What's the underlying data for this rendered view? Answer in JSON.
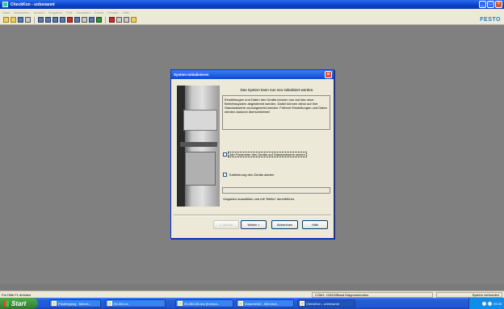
{
  "window": {
    "title": "CheckKon - unbenannt",
    "menu": [
      "Datei",
      "Bearbeiten",
      "Ansicht",
      "Vorgaben",
      "Prüf",
      "Verwalten",
      "Extras",
      "Fenster",
      "Hilfe"
    ],
    "brand": "FESTO",
    "controls": {
      "minimize": "_",
      "maximize": "□",
      "close": "×"
    }
  },
  "toolbar": {
    "icons": [
      "new-icon",
      "open-icon",
      "save-icon",
      "print-icon",
      "grid-icon",
      "grid-icon",
      "grid-icon",
      "grid-icon",
      "grid-icon",
      "grid-icon",
      "grid-icon",
      "grid-icon",
      "grid-icon",
      "cut-icon",
      "delete-icon",
      "zoom-icon",
      "help-icon"
    ]
  },
  "dialog": {
    "title": "System Initialisieren",
    "close_glyph": "×",
    "heading": "Das System kann nun neu initialisiert werden.",
    "info": "Einstellungen und Daten des Geräts können nun auf das neue Betriebssystem abgestimmt werden. Dabei können diese auf ihre Standardwerte zurückgesetzt werden. Frühere Einstellungen und Daten werden dadurch überschrieben!",
    "checkbox1": {
      "label": "Alle Parameter des Geräts auf Standardwerte setzen",
      "checked": false
    },
    "checkbox2": {
      "label": "Kalibrierung des Geräts starten",
      "checked": false
    },
    "progress": 0,
    "hint": "Vorgaben auswählen und mit 'Weiter' durchführen.",
    "buttons": {
      "back": "< Zurück",
      "next": "Weiter >",
      "cancel": "Abbrechen",
      "help": "Hilfe"
    }
  },
  "statusbar": {
    "left": "Für Hilfe F1 drücken",
    "middle": "COM1: 115200Baud Diagnosemodus",
    "right": "System verbunden"
  },
  "taskbar": {
    "start": "Start",
    "tasks": [
      {
        "label": "Posteingang - Micros..."
      },
      {
        "label": "05-063-xx"
      },
      {
        "label": "05-063-05.doc [Kompa..."
      },
      {
        "label": "Dokument2 - Microsof..."
      },
      {
        "label": "CheckKon - unbenannt"
      }
    ],
    "clock": "09:35"
  },
  "colors": {
    "title_blue": "#0a48d6",
    "festo_blue": "#1b79c7",
    "start_green": "#3c8f3c",
    "close_red": "#e04a2a"
  }
}
